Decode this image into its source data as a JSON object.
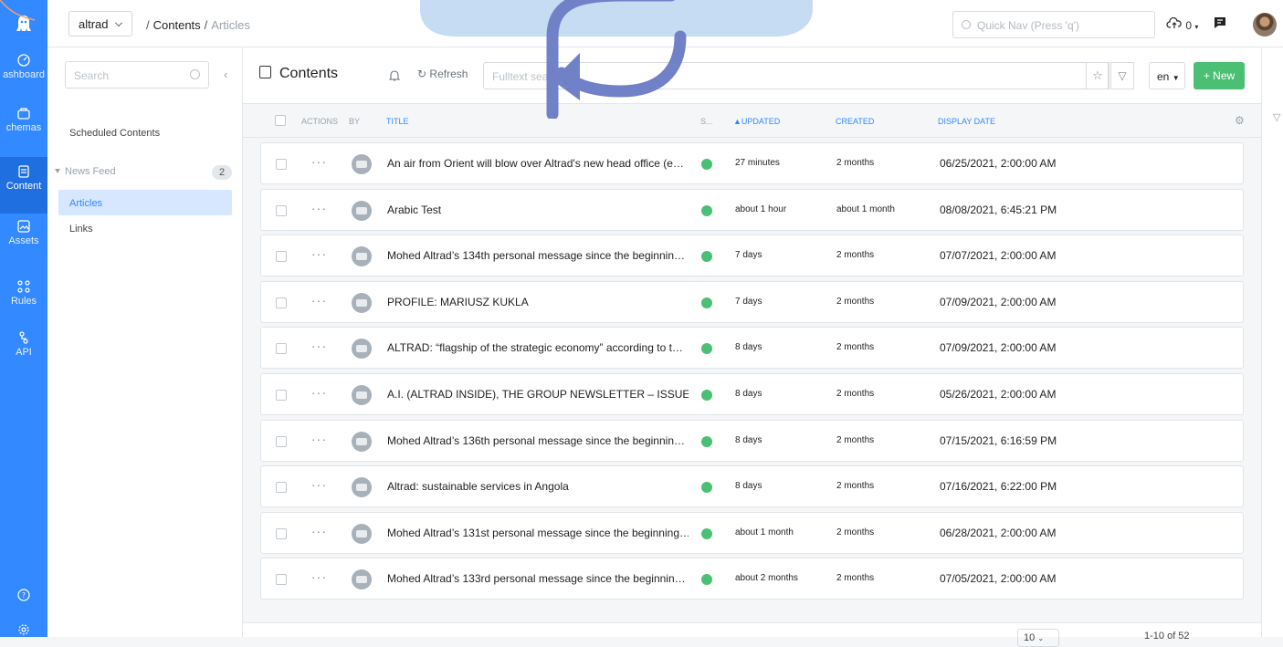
{
  "rail": {
    "items": [
      {
        "label": "ashboard",
        "icon": "dashboard-icon"
      },
      {
        "label": "chemas",
        "icon": "schemas-icon"
      },
      {
        "label": "Content",
        "icon": "content-icon",
        "active": true
      },
      {
        "label": "Assets",
        "icon": "assets-icon"
      },
      {
        "label": "Rules",
        "icon": "rules-icon"
      },
      {
        "label": "API",
        "icon": "api-icon"
      }
    ],
    "help_icon": "help-icon",
    "settings_icon": "settings-icon"
  },
  "header": {
    "app": "altrad",
    "breadcrumb": {
      "section": "Contents",
      "current": "Articles"
    },
    "quick_nav_placeholder": "Quick Nav (Press 'q')",
    "notifications_count": "0"
  },
  "sidebar": {
    "search_placeholder": "Search",
    "scheduled": "Scheduled Contents",
    "folder": "News Feed",
    "folder_count": "2",
    "items": [
      "Articles",
      "Links"
    ]
  },
  "toolbar": {
    "title": "Contents",
    "refresh": "Refresh",
    "fulltext_placeholder": "Fulltext search",
    "language": "en",
    "new_label": "+ New"
  },
  "table": {
    "headers": {
      "actions": "ACTIONS",
      "by": "BY",
      "title": "TITLE",
      "status": "S...",
      "updated": "▲UPDATED",
      "created": "CREATED",
      "display_date": "DISPLAY DATE"
    },
    "rows": [
      {
        "title": "An air from Orient will blow over Altrad's new head office (e…",
        "updated": "27 minutes",
        "created": "2 months",
        "display_date": "06/25/2021, 2:00:00 AM"
      },
      {
        "title": "Arabic Test",
        "updated": "about 1 hour",
        "created": "about 1 month",
        "display_date": "08/08/2021, 6:45:21 PM"
      },
      {
        "title": "Mohed Altrad’s 134th personal message since the beginnin…",
        "updated": "7 days",
        "created": "2 months",
        "display_date": "07/07/2021, 2:00:00 AM"
      },
      {
        "title": "PROFILE: MARIUSZ KUKLA",
        "updated": "7 days",
        "created": "2 months",
        "display_date": "07/09/2021, 2:00:00 AM"
      },
      {
        "title": "ALTRAD: “flagship of the strategic economy” according to t…",
        "updated": "8 days",
        "created": "2 months",
        "display_date": "07/09/2021, 2:00:00 AM"
      },
      {
        "title": "A.I. (ALTRAD INSIDE), THE GROUP NEWSLETTER – ISSUE #…",
        "updated": "8 days",
        "created": "2 months",
        "display_date": "05/26/2021, 2:00:00 AM"
      },
      {
        "title": "Mohed Altrad’s 136th personal message since the beginnin…",
        "updated": "8 days",
        "created": "2 months",
        "display_date": "07/15/2021, 6:16:59 PM"
      },
      {
        "title": "Altrad: sustainable services in Angola",
        "updated": "8 days",
        "created": "2 months",
        "display_date": "07/16/2021, 6:22:00 PM"
      },
      {
        "title": "Mohed Altrad’s 131st personal message since the beginning…",
        "updated": "about 1 month",
        "created": "2 months",
        "display_date": "06/28/2021, 2:00:00 AM"
      },
      {
        "title": "Mohed Altrad’s 133rd personal message since the beginnin…",
        "updated": "about 2 months",
        "created": "2 months",
        "display_date": "07/05/2021, 2:00:00 AM"
      }
    ]
  },
  "footer": {
    "page_size": "10",
    "range": "1-10 of 52"
  },
  "colors": {
    "rail": "#3389ff",
    "accent": "#3389ff",
    "new_button": "#4bbf73",
    "status_published": "#4bbf73",
    "active_item": "#d6e7ff"
  }
}
